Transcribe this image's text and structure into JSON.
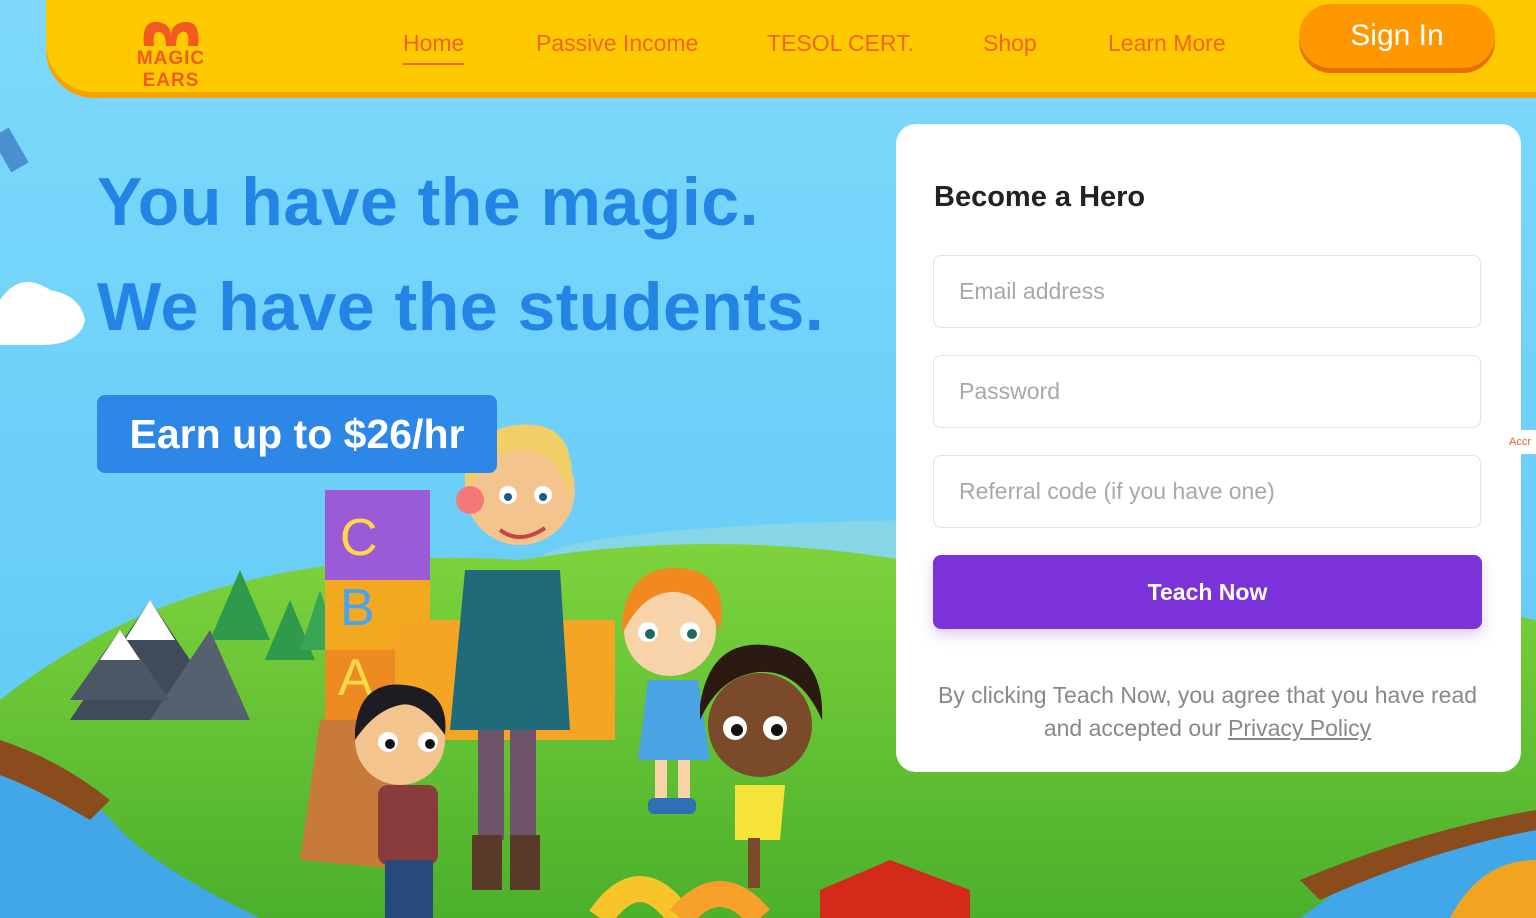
{
  "header": {
    "logo_text": "MAGIC EARS",
    "nav": [
      "Home",
      "Passive Income",
      "TESOL CERT.",
      "Shop",
      "Learn More"
    ],
    "active_nav": "Home",
    "sign_in": "Sign In"
  },
  "hero": {
    "line1": "You have the magic.",
    "line2": "We have the students.",
    "badge": "Earn up to $26/hr",
    "block_letters": [
      "C",
      "B",
      "A"
    ]
  },
  "form": {
    "title": "Become a Hero",
    "email_placeholder": "Email address",
    "password_placeholder": "Password",
    "referral_placeholder": "Referral code (if you have one)",
    "submit": "Teach Now",
    "disclaimer_prefix": "By clicking Teach Now, you agree that you have read and accepted our ",
    "privacy_link": "Privacy Policy"
  },
  "side_tab": "Accr",
  "colors": {
    "header": "#ffc900",
    "accent": "#ff9800",
    "hero_text": "#2384e6",
    "button": "#7b32d9"
  }
}
